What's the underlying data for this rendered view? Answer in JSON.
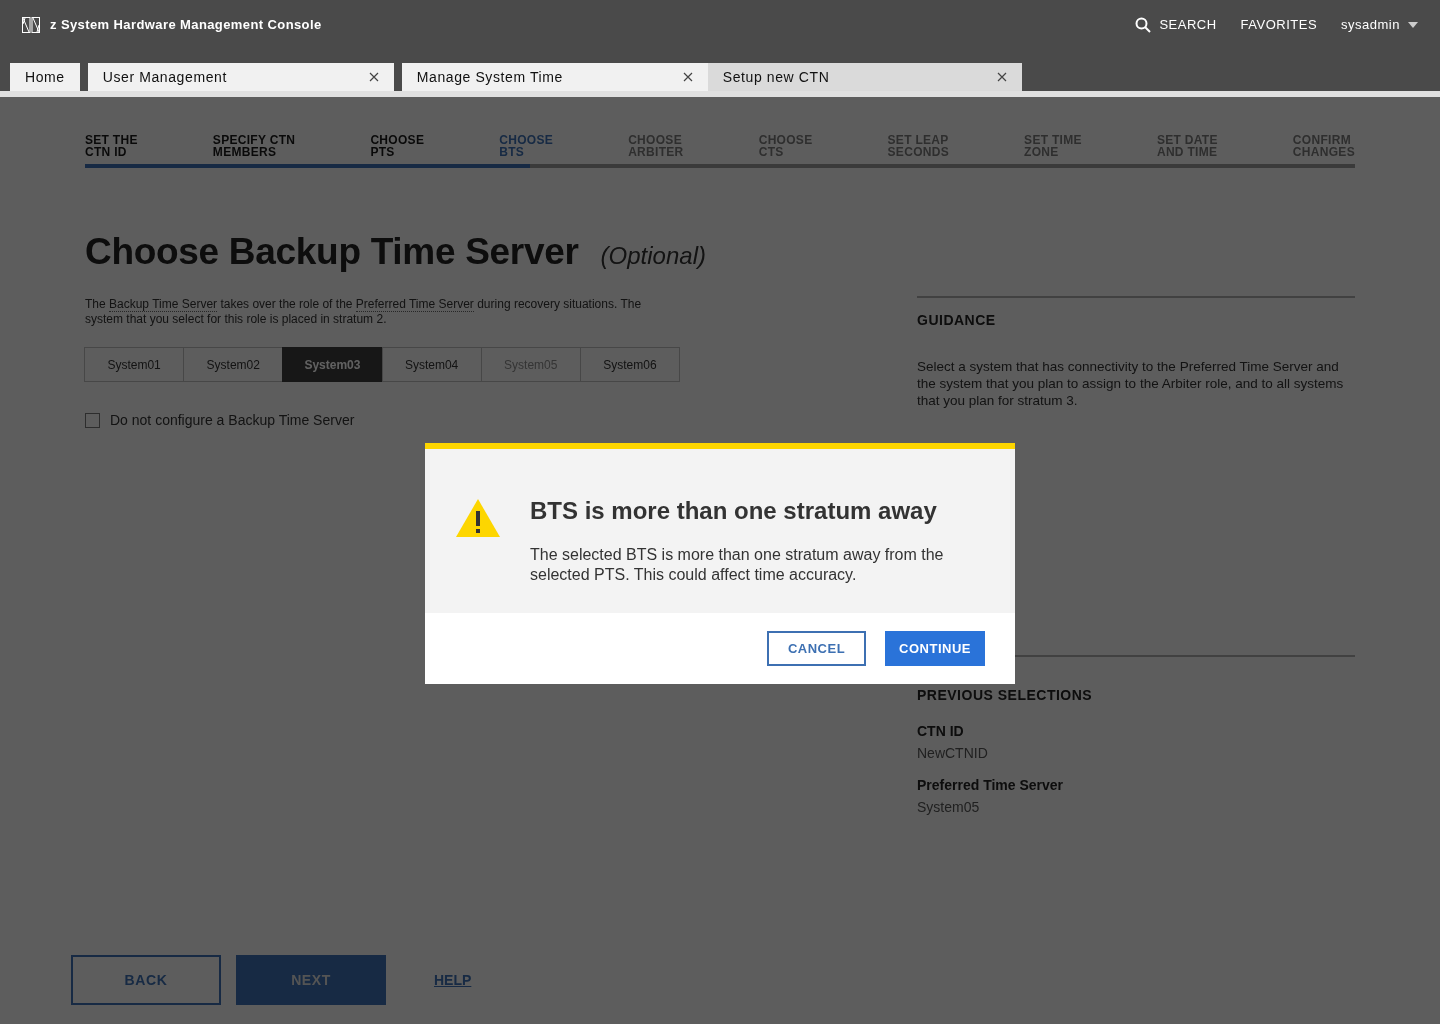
{
  "app": {
    "title": "z System Hardware Management Console",
    "search": "SEARCH",
    "favorites": "FAVORITES",
    "user": "sysadmin"
  },
  "tabs": [
    {
      "label": "Home",
      "selected": false,
      "closable": false
    },
    {
      "label": "User Management",
      "selected": false,
      "closable": true
    },
    {
      "label": "Manage System Time",
      "selected": false,
      "closable": true
    },
    {
      "label": "Setup new CTN",
      "selected": true,
      "closable": true
    }
  ],
  "steps": [
    {
      "label": "SET THE\nCTN ID",
      "completed": true,
      "selected": false
    },
    {
      "label": "SPECIFY CTN\nMEMBERS",
      "completed": true,
      "selected": false
    },
    {
      "label": "CHOOSE\nPTS",
      "completed": true,
      "selected": false
    },
    {
      "label": "CHOOSE\nBTS",
      "completed": false,
      "selected": true
    },
    {
      "label": "CHOOSE\nARBITER",
      "completed": false,
      "selected": false
    },
    {
      "label": "CHOOSE\nCTS",
      "completed": false,
      "selected": false
    },
    {
      "label": "SET LEAP\nSECONDS",
      "completed": false,
      "selected": false
    },
    {
      "label": "SET TIME\nZONE",
      "completed": false,
      "selected": false
    },
    {
      "label": "SET DATE\nAND TIME",
      "completed": false,
      "selected": false
    },
    {
      "label": "CONFIRM\nCHANGES",
      "completed": false,
      "selected": false
    }
  ],
  "progress": {
    "level": 0.35
  },
  "page": {
    "title": "Choose Backup Time Server",
    "optional": "(Optional)",
    "description": [
      {
        "text": "The ",
        "term": false
      },
      {
        "text": "Backup Time Server",
        "term": true
      },
      {
        "text": " takes over the role of the ",
        "term": false
      },
      {
        "text": "Preferred Time Server",
        "term": true
      },
      {
        "text": " during recovery situations. The system that you select for this role is placed in stratum 2.",
        "term": false
      }
    ]
  },
  "systems": [
    {
      "label": "System01",
      "selected": false,
      "disabled": false
    },
    {
      "label": "System02",
      "selected": false,
      "disabled": false
    },
    {
      "label": "System03",
      "selected": true,
      "disabled": false
    },
    {
      "label": "System04",
      "selected": false,
      "disabled": false
    },
    {
      "label": "System05",
      "selected": false,
      "disabled": true
    },
    {
      "label": "System06",
      "selected": false,
      "disabled": false
    }
  ],
  "no_backup": {
    "label": "Do not configure a Backup Time Server",
    "checked": false
  },
  "guidance": {
    "heading": "GUIDANCE",
    "text": "Select a system that has connectivity to the Preferred Time Server and the system that you plan to assign to the Arbiter role, and to all systems that you plan for stratum 3."
  },
  "previous": {
    "heading": "PREVIOUS SELECTIONS",
    "items": [
      {
        "label": "CTN ID",
        "value": "NewCTNID"
      },
      {
        "label": "Preferred Time Server",
        "value": "System05"
      }
    ]
  },
  "footer": {
    "back": "BACK",
    "next": "NEXT",
    "help": "HELP"
  },
  "dialog": {
    "title": "BTS is more than one stratum away",
    "message": "The selected BTS is more than one stratum away from the selected PTS. This could affect time accuracy.",
    "cancel": "CANCEL",
    "continue": "CONTINUE"
  }
}
